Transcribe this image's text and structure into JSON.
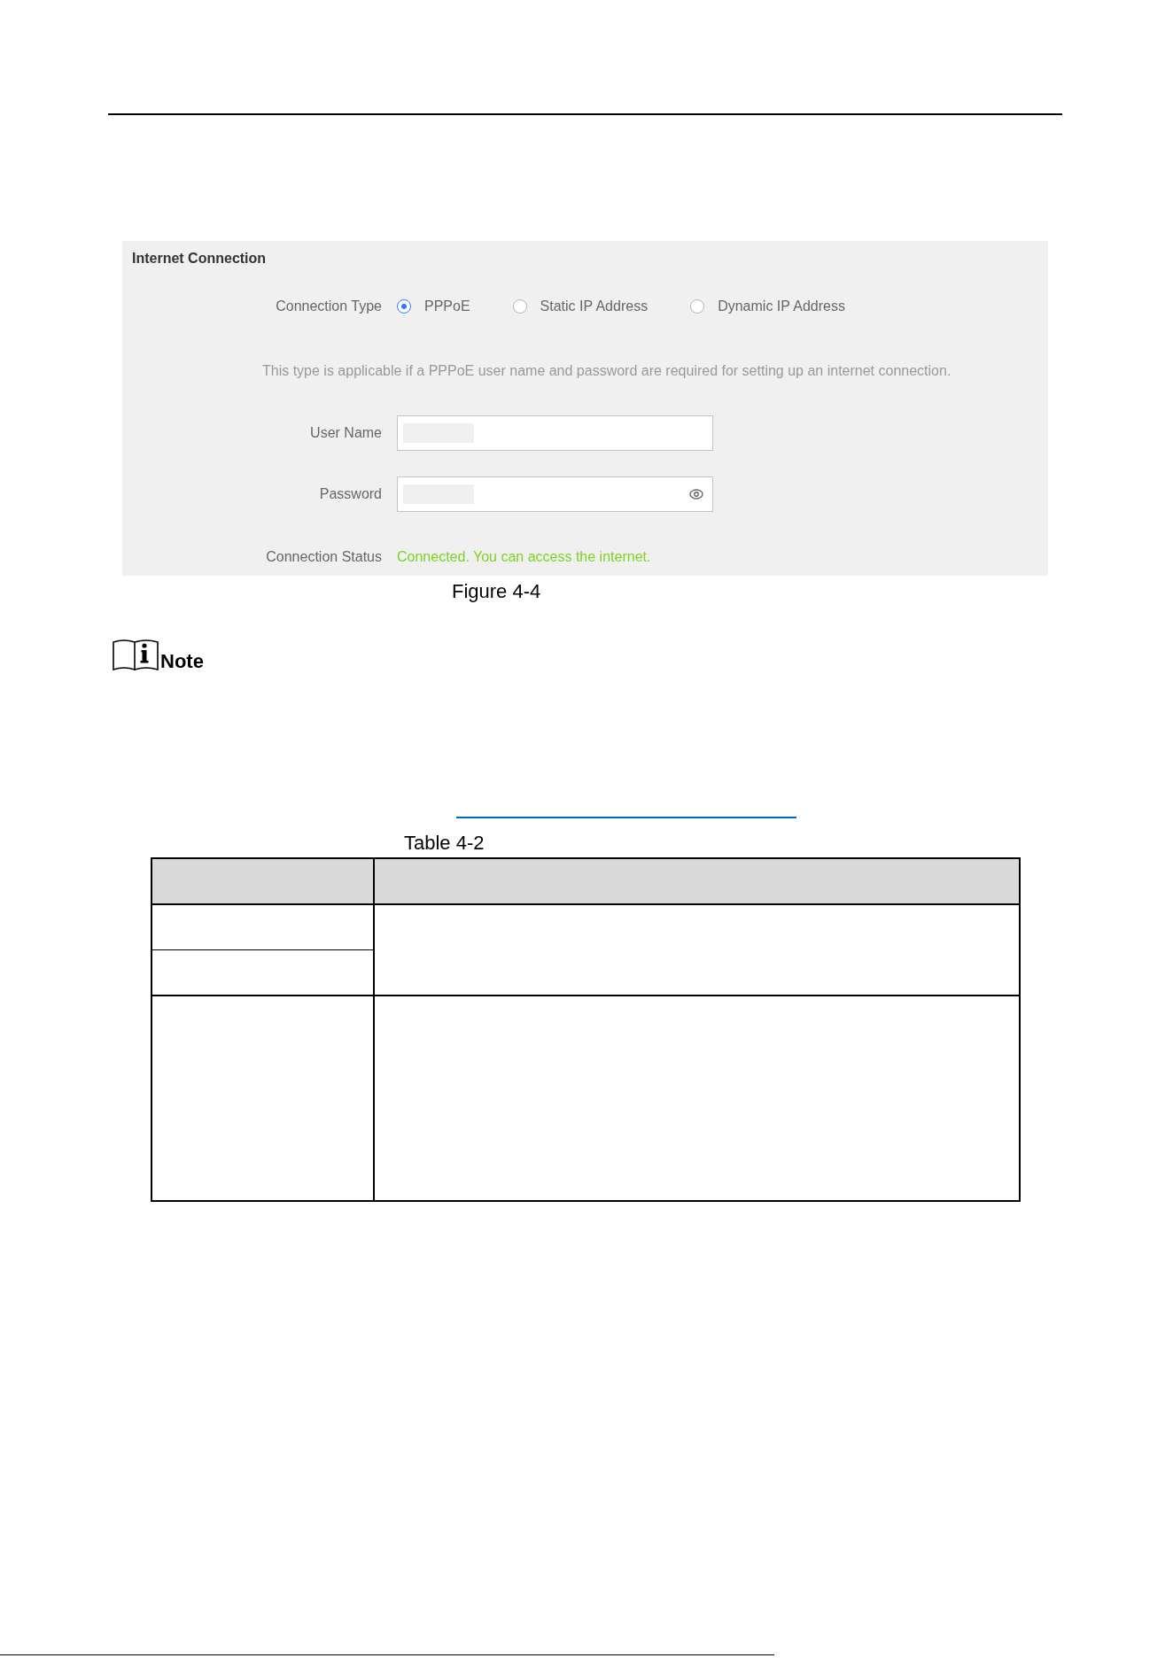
{
  "figure": {
    "title": "Internet Connection",
    "connection_type": {
      "label": "Connection Type",
      "options": [
        {
          "label": "PPPoE",
          "selected": true
        },
        {
          "label": "Static IP Address",
          "selected": false
        },
        {
          "label": "Dynamic IP Address",
          "selected": false
        }
      ]
    },
    "description": "This type is applicable if a PPPoE user name and password are required for setting up an internet connection.",
    "fields": [
      {
        "label": "User Name",
        "kind": "text",
        "redacted": true
      },
      {
        "label": "Password",
        "kind": "password",
        "redacted": true
      }
    ],
    "status": {
      "label": "Connection Status",
      "value": "Connected. You can access the internet.",
      "connected": true
    }
  },
  "figure_caption": "Figure 4-4",
  "note": {
    "heading": "Note"
  },
  "table": {
    "caption": "Table 4-2"
  }
}
